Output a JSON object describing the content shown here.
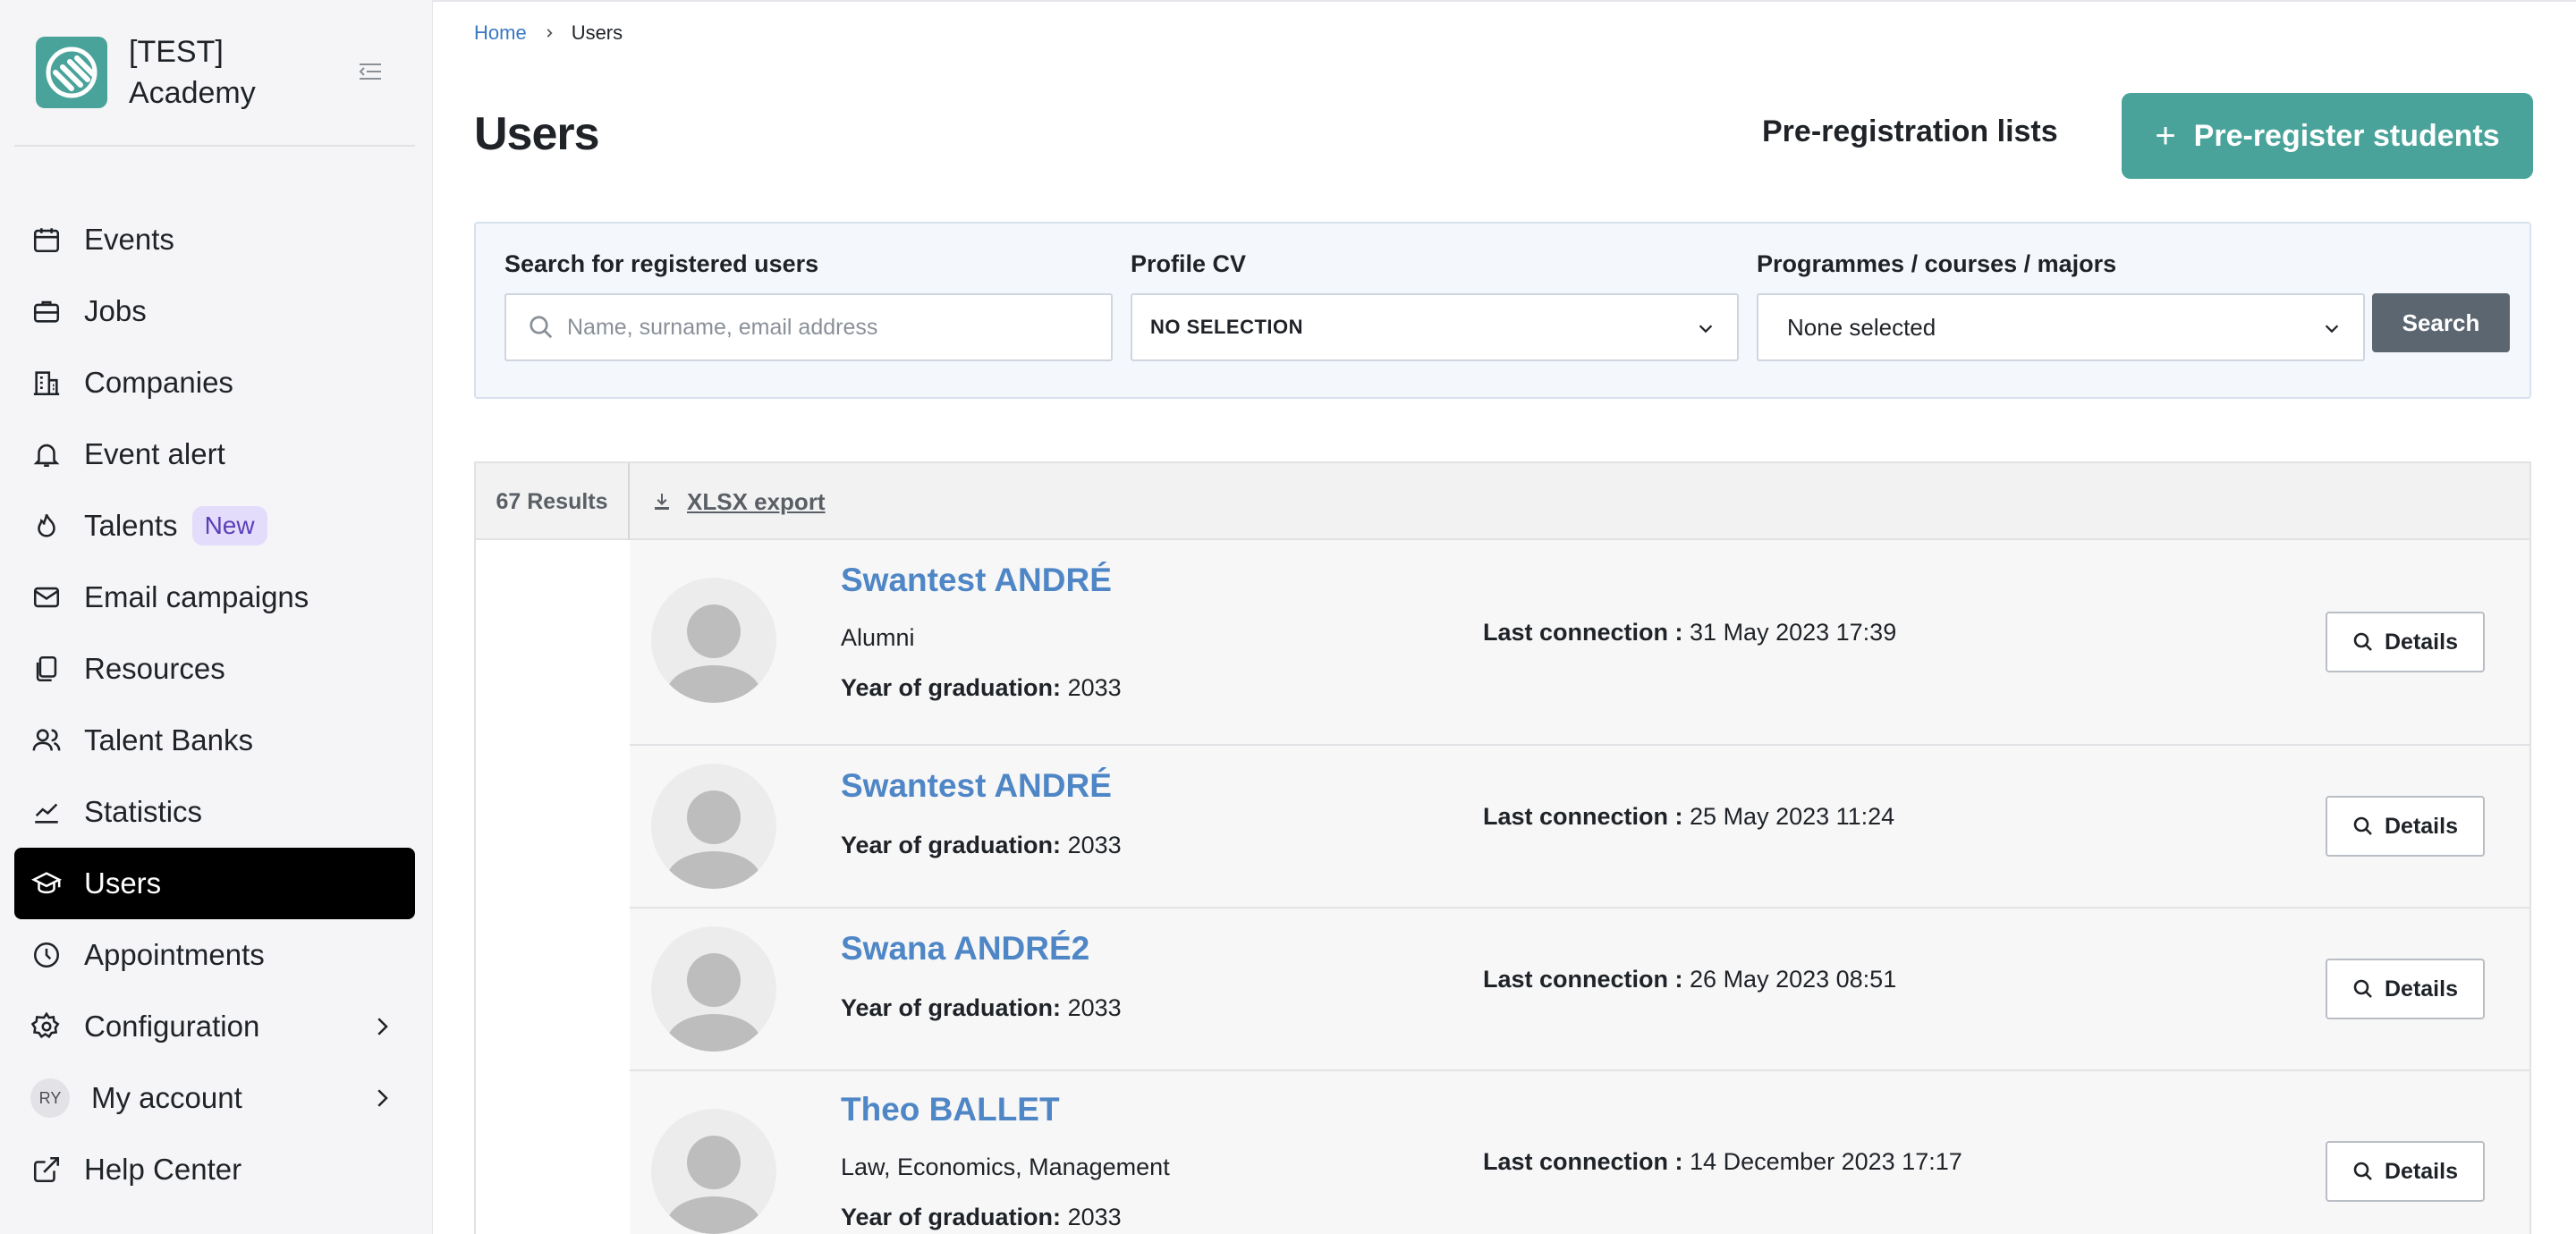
{
  "brand": {
    "name": "[TEST] Academy"
  },
  "nav": {
    "items": [
      {
        "label": "Events",
        "icon": "calendar-icon"
      },
      {
        "label": "Jobs",
        "icon": "briefcase-icon"
      },
      {
        "label": "Companies",
        "icon": "building-icon"
      },
      {
        "label": "Event alert",
        "icon": "bell-icon"
      },
      {
        "label": "Talents",
        "icon": "flame-icon",
        "badge": "New"
      },
      {
        "label": "Email campaigns",
        "icon": "mail-icon"
      },
      {
        "label": "Resources",
        "icon": "documents-icon"
      },
      {
        "label": "Talent Banks",
        "icon": "users-icon"
      },
      {
        "label": "Statistics",
        "icon": "chart-icon"
      },
      {
        "label": "Users",
        "icon": "graduation-cap-icon",
        "active": true
      },
      {
        "label": "Appointments",
        "icon": "clock-icon"
      },
      {
        "label": "Configuration",
        "icon": "gear-icon"
      },
      {
        "label": "My account",
        "avatar": "RY"
      },
      {
        "label": "Help Center",
        "icon": "external-link-icon"
      }
    ]
  },
  "breadcrumb": {
    "home": "Home",
    "current": "Users"
  },
  "page": {
    "title": "Users",
    "prereg_lists": "Pre-registration lists",
    "prereg_button": "Pre-register students"
  },
  "filters": {
    "search_label": "Search for registered users",
    "search_placeholder": "Name, surname, email address",
    "cv_label": "Profile CV",
    "cv_value": "NO SELECTION",
    "programmes_label": "Programmes / courses / majors",
    "programmes_value": "None selected",
    "search_button": "Search"
  },
  "results": {
    "count": "67 Results",
    "export": "XLSX export",
    "last_connection_label": "Last connection :",
    "graduation_label": "Year of graduation:",
    "details_label": "Details",
    "users": [
      {
        "name": "Swantest ANDRÉ",
        "status": "Alumni",
        "graduation": "2033",
        "last_connection": "31 May 2023 17:39"
      },
      {
        "name": "Swantest ANDRÉ",
        "graduation": "2033",
        "last_connection": "25 May 2023 11:24"
      },
      {
        "name": "Swana ANDRÉ2",
        "graduation": "2033",
        "last_connection": "26 May 2023 08:51"
      },
      {
        "name": "Theo BALLET",
        "status": "Law, Economics, Management",
        "graduation": "2033",
        "last_connection": "14 December 2023 17:17"
      }
    ]
  }
}
